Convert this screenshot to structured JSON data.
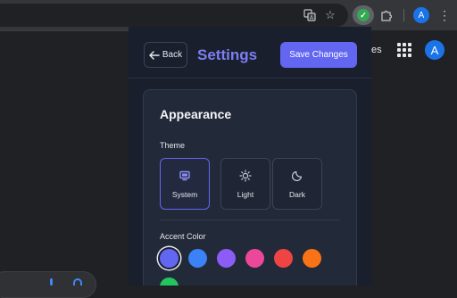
{
  "browser": {
    "account_initial": "A",
    "icons": [
      "translate-icon",
      "star-icon",
      "extension-active-icon",
      "puzzle-icon",
      "kebab-menu-icon"
    ]
  },
  "background_page": {
    "partial_text": "es",
    "account_initial": "A"
  },
  "popup": {
    "back_label": "Back",
    "title": "Settings",
    "save_label": "Save Changes",
    "appearance": {
      "heading": "Appearance",
      "theme_label": "Theme",
      "theme_options": [
        {
          "label": "System",
          "icon": "monitor-icon",
          "selected": true
        },
        {
          "label": "Light",
          "icon": "sun-icon",
          "selected": false
        },
        {
          "label": "Dark",
          "icon": "moon-icon",
          "selected": false
        }
      ],
      "accent_label": "Accent Color",
      "accent_colors": [
        "#6366f1",
        "#3b82f6",
        "#8b5cf6",
        "#ec4899",
        "#ef4444",
        "#f97316",
        "#22c55e"
      ],
      "selected_accent": "#6366f1"
    }
  },
  "colors": {
    "accent": "#6366f1",
    "popup_bg": "#1a1f2e",
    "card_bg": "#222939"
  }
}
